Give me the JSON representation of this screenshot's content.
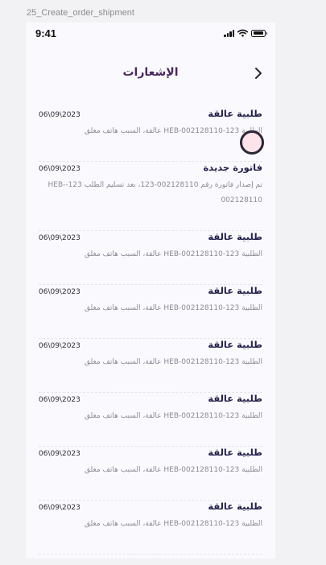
{
  "frame_label": "25_Create_order_shipment",
  "status_bar": {
    "time": "9:41"
  },
  "header": {
    "title": "الإشعارات",
    "back_icon": "chevron-icon"
  },
  "notifications": [
    {
      "title": "طلبية عالقة",
      "date": "06\\09\\2023",
      "body": "الطلبية 123-HEB-002128110 عالقة، السبب هاتف مغلق"
    },
    {
      "title": "فاتورة جديدة",
      "date": "06\\09\\2023",
      "body": "تم إصدار فاتورة رقم 002128110-123، بعد تسليم الطلب 123-HEB-002128110"
    },
    {
      "title": "طلبية عالقة",
      "date": "06\\09\\2023",
      "body": "الطلبية 123-HEB-002128110 عالقة، السبب هاتف مغلق"
    },
    {
      "title": "طلبية عالقة",
      "date": "06\\09\\2023",
      "body": "الطلبية 123-HEB-002128110 عالقة، السبب هاتف مغلق"
    },
    {
      "title": "طلبية عالقة",
      "date": "06\\09\\2023",
      "body": "الطلبية 123-HEB-002128110 عالقة، السبب هاتف مغلق"
    },
    {
      "title": "طلبية عالقة",
      "date": "06\\09\\2023",
      "body": "الطلبية 123-HEB-002128110 عالقة، السبب هاتف مغلق"
    },
    {
      "title": "طلبية عالقة",
      "date": "06\\09\\2023",
      "body": "الطلبية 123-HEB-002128110 عالقة، السبب هاتف مغلق"
    },
    {
      "title": "طلبية عالقة",
      "date": "06\\09\\2023",
      "body": "الطلبية 123-HEB-002128110 عالقة، السبب هاتف مغلق"
    }
  ],
  "colors": {
    "title": "#4a2760",
    "item_title": "#23204a",
    "body_text": "#8d8a98",
    "fab_fill": "#fde3ea"
  }
}
